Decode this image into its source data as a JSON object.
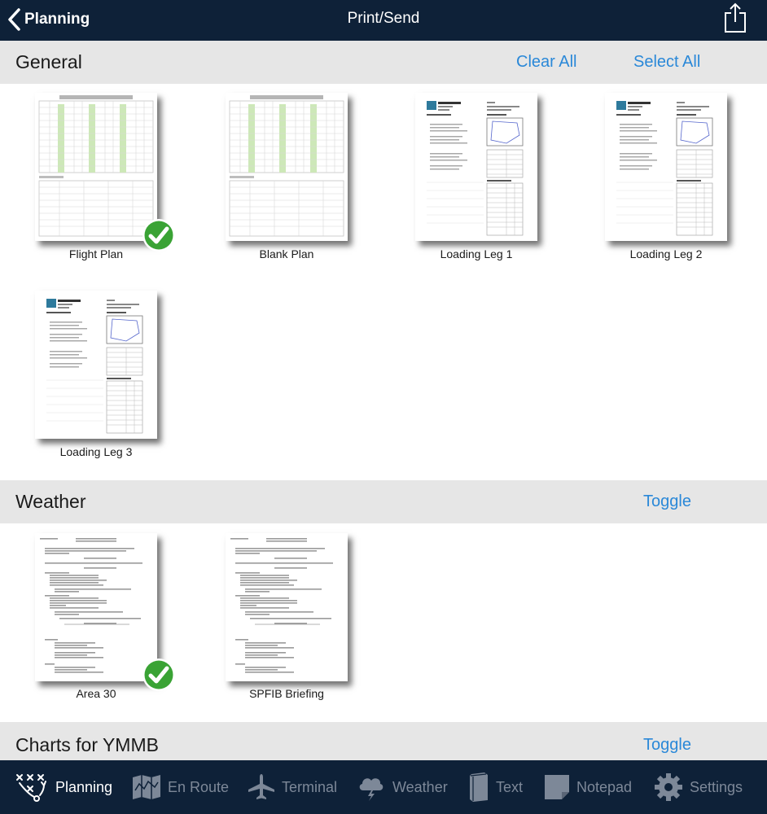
{
  "nav": {
    "back_label": "Planning",
    "title": "Print/Send"
  },
  "general": {
    "title": "General",
    "clear_all": "Clear All",
    "select_all": "Select All",
    "items": [
      {
        "label": "Flight Plan",
        "selected": true
      },
      {
        "label": "Blank Plan",
        "selected": false
      },
      {
        "label": "Loading Leg 1",
        "selected": false
      },
      {
        "label": "Loading Leg 2",
        "selected": false
      },
      {
        "label": "Loading Leg 3",
        "selected": false
      }
    ]
  },
  "weather": {
    "title": "Weather",
    "toggle": "Toggle",
    "items": [
      {
        "label": "Area 30",
        "selected": true
      },
      {
        "label": "SPFIB Briefing",
        "selected": false
      }
    ]
  },
  "charts": {
    "title": "Charts for YMMB",
    "toggle": "Toggle"
  },
  "tabs": [
    {
      "label": "Planning",
      "icon": "planning-icon",
      "active": true
    },
    {
      "label": "En Route",
      "icon": "map-icon",
      "active": false
    },
    {
      "label": "Terminal",
      "icon": "airplane-icon",
      "active": false
    },
    {
      "label": "Weather",
      "icon": "weather-icon",
      "active": false
    },
    {
      "label": "Text",
      "icon": "book-icon",
      "active": false
    },
    {
      "label": "Notepad",
      "icon": "notepad-icon",
      "active": false
    },
    {
      "label": "Settings",
      "icon": "gear-icon",
      "active": false
    }
  ],
  "colors": {
    "nav_bg": "#0e2138",
    "accent": "#2a88d8",
    "section_bg": "#e6e6e6",
    "check_green": "#3aa335"
  }
}
